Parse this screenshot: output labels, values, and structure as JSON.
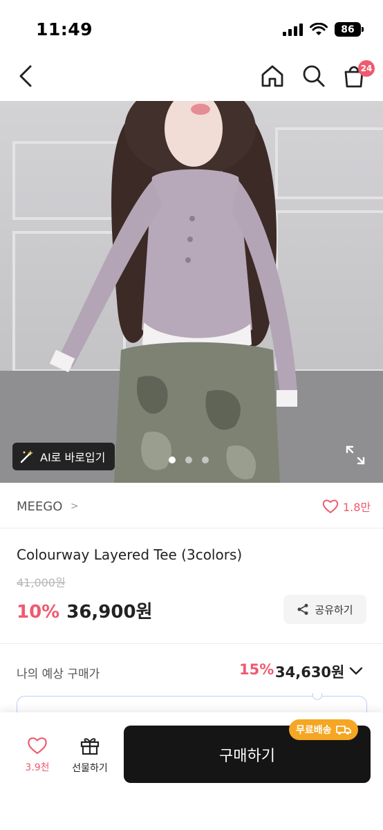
{
  "status": {
    "time": "11:49",
    "battery": "86"
  },
  "nav": {
    "cart_count": "24"
  },
  "gallery": {
    "ai_label": "AI로 바로입기",
    "current_slide": 1,
    "total_slides": 3
  },
  "brand": {
    "name": "MEEGO",
    "chevron": ">",
    "likes": "1.8만"
  },
  "product": {
    "title": "Colourway Layered Tee (3colors)",
    "original_price": "41,000원",
    "discount": "10%",
    "sale_price": "36,900원",
    "share_label": "공유하기"
  },
  "expected": {
    "label": "나의 예상 구매가",
    "discount": "15%",
    "price": "34,630원"
  },
  "bottom": {
    "like_count": "3.9천",
    "gift_label": "선물하기",
    "buy_label": "구매하기",
    "free_shipping": "무료배송"
  },
  "colors": {
    "accent": "#ef5a6f",
    "buy": "#151515",
    "badge": "#f5a623"
  }
}
